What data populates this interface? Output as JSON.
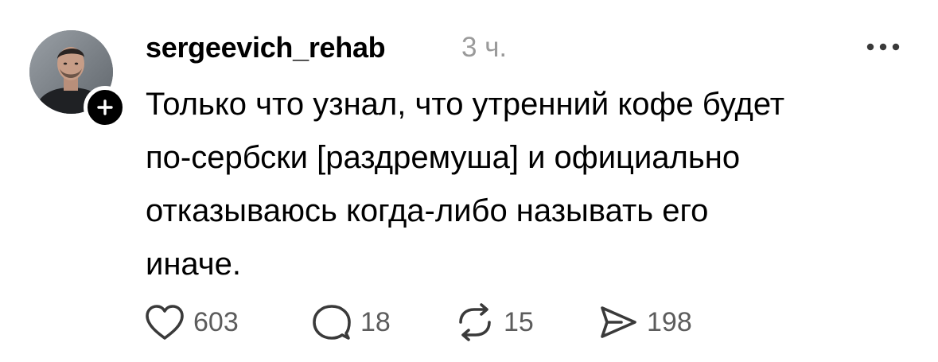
{
  "post": {
    "username": "sergeevich_rehab",
    "timestamp": "3 ч.",
    "text": "Только что узнал, что утренний кофе будет\nпо-сербски [раздремуша] и официально\nотказываюсь когда-либо называть его\nиначе.",
    "avatar_icon": "user-photo",
    "follow_icon": "plus-icon",
    "more_icon": "more-horizontal-icon"
  },
  "actions": {
    "likes": "603",
    "replies": "18",
    "reposts": "15",
    "shares": "198",
    "icons": {
      "like": "heart-icon",
      "reply": "comment-bubble-icon",
      "repost": "repost-icon",
      "share": "send-icon"
    }
  },
  "colors": {
    "text": "#000000",
    "muted": "#9a9a9a",
    "count": "#5c5c5c",
    "icon": "#3a3a3a"
  }
}
